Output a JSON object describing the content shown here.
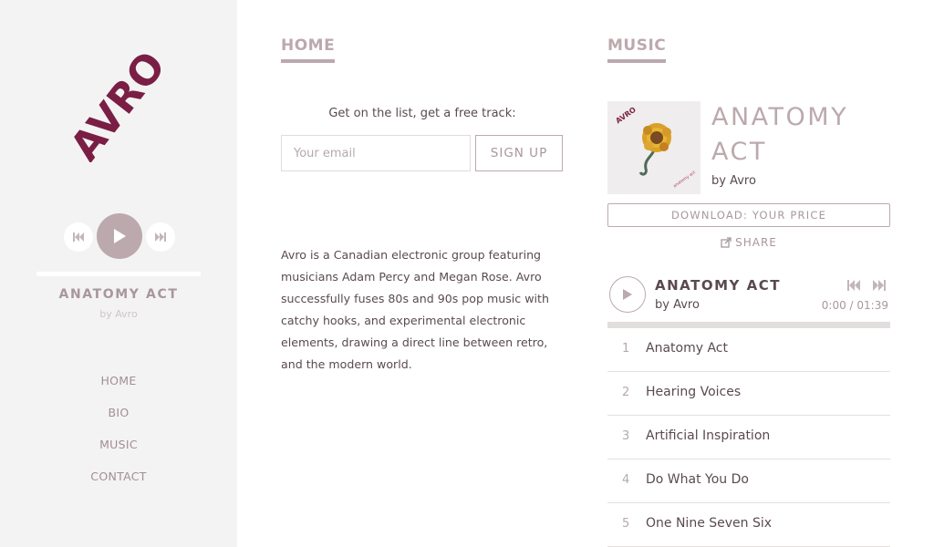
{
  "sidebar": {
    "logo_text": "AVRO",
    "player": {
      "track_title": "ANATOMY ACT",
      "artist": "by Avro"
    },
    "nav": [
      "HOME",
      "BIO",
      "MUSIC",
      "CONTACT"
    ]
  },
  "home": {
    "heading": "HOME",
    "signup_prompt": "Get on the list, get a free track:",
    "email_placeholder": "Your email",
    "signup_label": "SIGN UP",
    "bio": "Avro is a Canadian electronic group featuring musicians Adam Percy and Megan Rose. Avro successfully fuses 80s and 90s pop music with catchy hooks, and experimental electronic elements, drawing a direct line between retro, and the modern world."
  },
  "music": {
    "heading": "MUSIC",
    "album_title": "ANATOMY ACT",
    "album_artist": "by Avro",
    "download_label": "DOWNLOAD: YOUR PRICE",
    "share_label": "SHARE",
    "player": {
      "title": "ANATOMY ACT",
      "artist": "by Avro",
      "time": "0:00 / 01:39"
    },
    "tracks": [
      {
        "num": "1",
        "name": "Anatomy Act"
      },
      {
        "num": "2",
        "name": "Hearing Voices"
      },
      {
        "num": "3",
        "name": "Artificial Inspiration"
      },
      {
        "num": "4",
        "name": "Do What You Do"
      },
      {
        "num": "5",
        "name": "One Nine Seven Six"
      }
    ]
  },
  "colors": {
    "accent": "#bca9ad",
    "logo": "#7a1e45",
    "text": "#5a4a4f",
    "sidebar_bg": "#f4f3f3"
  }
}
